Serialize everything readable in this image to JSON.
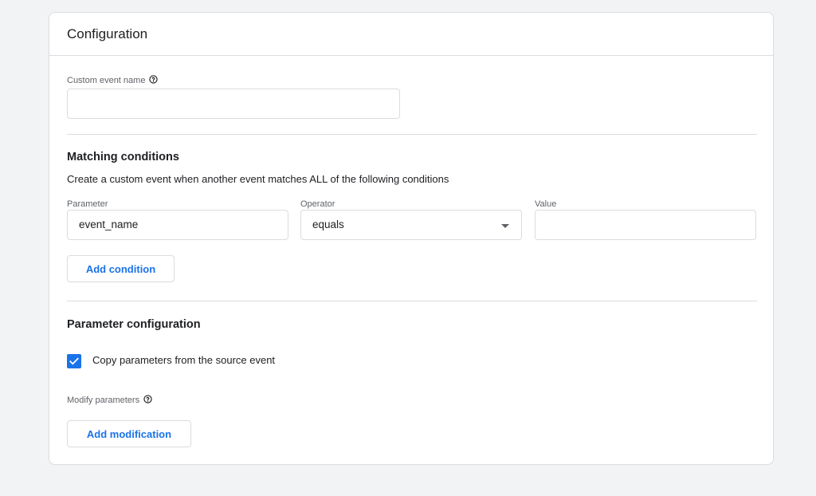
{
  "card": {
    "title": "Configuration"
  },
  "custom_event": {
    "label": "Custom event name",
    "help_icon": "help-circle-icon",
    "value": ""
  },
  "matching": {
    "title": "Matching conditions",
    "description": "Create a custom event when another event matches ALL of the following conditions",
    "parameter_label": "Parameter",
    "parameter_value": "event_name",
    "operator_label": "Operator",
    "operator_value": "equals",
    "value_label": "Value",
    "value_value": "",
    "add_condition_label": "Add condition"
  },
  "param_config": {
    "title": "Parameter configuration",
    "copy_label": "Copy parameters from the source event",
    "copy_checked": true,
    "modify_label": "Modify parameters",
    "help_icon": "help-circle-icon",
    "add_modification_label": "Add modification"
  },
  "colors": {
    "accent": "#1a73e8",
    "border": "#dadce0",
    "background": "#f1f3f4"
  }
}
